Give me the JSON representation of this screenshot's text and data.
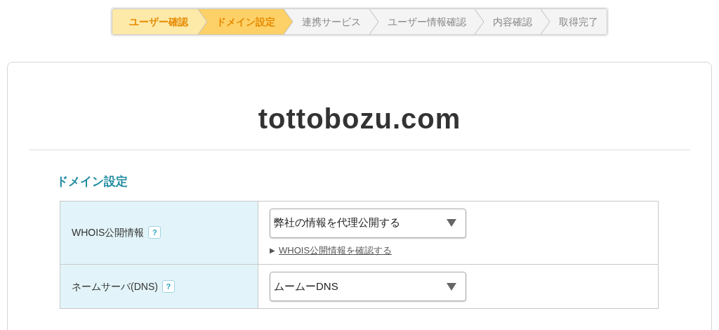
{
  "steps": [
    {
      "label": "ユーザー確認",
      "done": true,
      "selected": false
    },
    {
      "label": "ドメイン設定",
      "done": false,
      "selected": true
    },
    {
      "label": "連携サービス",
      "done": false,
      "selected": false
    },
    {
      "label": "ユーザー情報確認",
      "done": false,
      "selected": false
    },
    {
      "label": "内容確認",
      "done": false,
      "selected": false
    },
    {
      "label": "取得完了",
      "done": false,
      "selected": false
    }
  ],
  "domain": "tottobozu.com",
  "section_title": "ドメイン設定",
  "rows": [
    {
      "label": "WHOIS公開情報",
      "help": "?",
      "value": "弊社の情報を代理公開する",
      "link": "WHOIS公開情報を確認する",
      "link_marker": "▶"
    },
    {
      "label": "ネームサーバ(DNS)",
      "help": "?",
      "value": "ムームーDNS"
    }
  ]
}
